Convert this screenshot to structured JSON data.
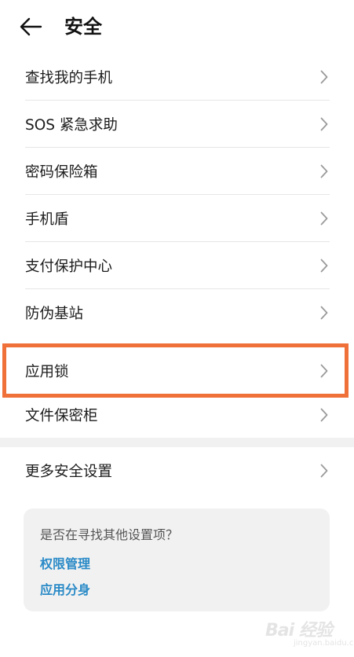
{
  "header": {
    "back_icon": "arrow-left-icon",
    "title": "安全"
  },
  "menu": {
    "items": [
      {
        "label": "查找我的手机"
      },
      {
        "label": "SOS 紧急求助"
      },
      {
        "label": "密码保险箱"
      },
      {
        "label": "手机盾"
      },
      {
        "label": "支付保护中心"
      },
      {
        "label": "防伪基站"
      },
      {
        "label": "应用锁",
        "highlighted": true
      },
      {
        "label": "文件保密柜"
      }
    ],
    "more": {
      "label": "更多安全设置"
    }
  },
  "colors": {
    "highlight_border": "#f0703a",
    "link": "#2a8ac7",
    "card_bg": "#f1f1f1"
  },
  "suggestions": {
    "question": "是否在寻找其他设置项？",
    "links": [
      {
        "label": "权限管理"
      },
      {
        "label": "应用分身"
      }
    ]
  },
  "watermark": {
    "logo_text": "Bai 经验",
    "sub_text": "jingyan.baidu.com"
  }
}
